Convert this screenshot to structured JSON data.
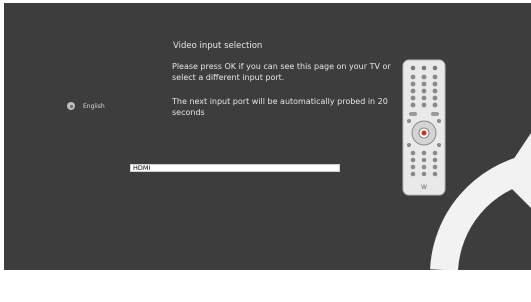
{
  "screen": {
    "title": "Video input selection",
    "message_ok": "Please press OK if you can see this page on your TV or select a different input port.",
    "message_probe": "The next input port will be automatically probed in 20 seconds"
  },
  "language": {
    "label": "English",
    "icon": "radio-icon"
  },
  "input_port": {
    "selected": "HDMI"
  },
  "remote": {
    "brand_mark": "W"
  },
  "colors": {
    "background": "#3d3d3d",
    "text": "#e6e6e6"
  }
}
